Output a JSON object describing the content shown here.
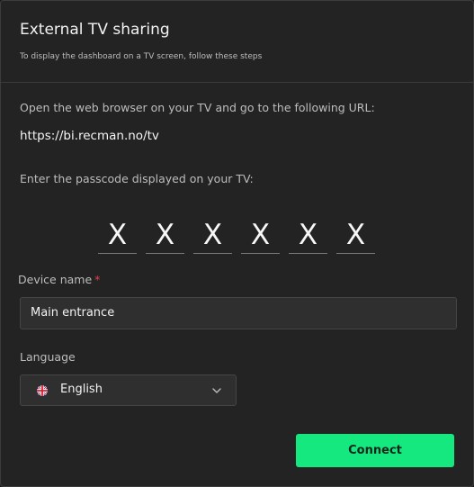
{
  "dialog": {
    "title": "External TV sharing",
    "subtitle": "To display the dashboard on a TV screen, follow these steps"
  },
  "steps": {
    "open_browser": "Open the web browser on your TV and go to the following URL:",
    "url": "https://bi.recman.no/tv",
    "enter_passcode": "Enter the passcode displayed on your TV:"
  },
  "passcode": [
    "X",
    "X",
    "X",
    "X",
    "X",
    "X"
  ],
  "device": {
    "label": "Device name",
    "required_mark": "*",
    "value": "Main entrance"
  },
  "language": {
    "label": "Language",
    "selected": "English",
    "flag_icon": "uk-flag-icon"
  },
  "actions": {
    "connect": "Connect"
  },
  "colors": {
    "accent": "#14e87f",
    "required": "#e0434c",
    "background": "#232323"
  }
}
